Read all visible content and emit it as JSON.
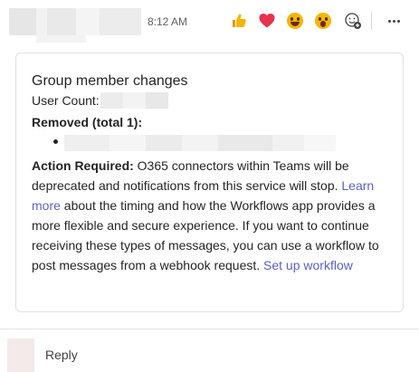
{
  "message": {
    "time": "8:12 AM"
  },
  "reactions": {
    "items": [
      "like-icon",
      "heart-icon",
      "laugh-icon",
      "surprised-icon"
    ],
    "add_icon": "add-reaction-icon",
    "more_icon": "more-options-icon"
  },
  "card": {
    "title": "Group member changes",
    "user_count_label": "User Count:",
    "removed_label": "Removed (total 1):",
    "action_required_label": "Action Required:",
    "action_text_1": " O365 connectors within Teams will be deprecated and notifications from this service will stop. ",
    "learn_more_link": "Learn more",
    "action_text_2": " about the timing and how the Workflows app provides a more flexible and secure experience. If you want to continue receiving these types of messages, you can use a workflow to post messages from a webhook request. ",
    "setup_workflow_link": "Set up workflow"
  },
  "reply": {
    "label": "Reply"
  },
  "colors": {
    "link": "#5b5fc7",
    "heart": "#e8314f",
    "emoji": "#f7b500"
  }
}
